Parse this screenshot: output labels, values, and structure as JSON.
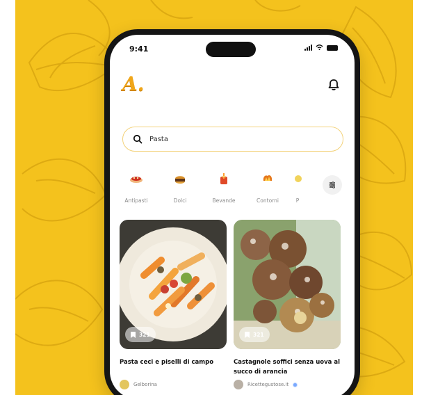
{
  "status_bar": {
    "time": "9:41"
  },
  "header": {
    "logo_text": "A.",
    "bell_icon": "bell-icon"
  },
  "search": {
    "value": "Pasta",
    "icon": "search-icon"
  },
  "categories": [
    {
      "label": "Antipasti",
      "icon": "appetizer-icon"
    },
    {
      "label": "Dolci",
      "icon": "dessert-icon"
    },
    {
      "label": "Bevande",
      "icon": "drink-icon"
    },
    {
      "label": "Contorni",
      "icon": "side-dish-icon"
    },
    {
      "label": "P",
      "icon": "more-category-icon"
    }
  ],
  "recipes": [
    {
      "title": "Pasta ceci e piselli di campo",
      "saves": "321",
      "author": "Gelborina",
      "image_icon": "pasta-dish-image"
    },
    {
      "title": "Castagnole soffici senza uova al succo di arancia",
      "saves": "321",
      "author": "Ricettegustose.it",
      "image_icon": "castagnole-dessert-image"
    }
  ],
  "colors": {
    "background": "#f4c21d",
    "accent": "#f0a619",
    "text": "#111111",
    "muted": "#8b8b8b",
    "search_border": "#f3d27a"
  }
}
